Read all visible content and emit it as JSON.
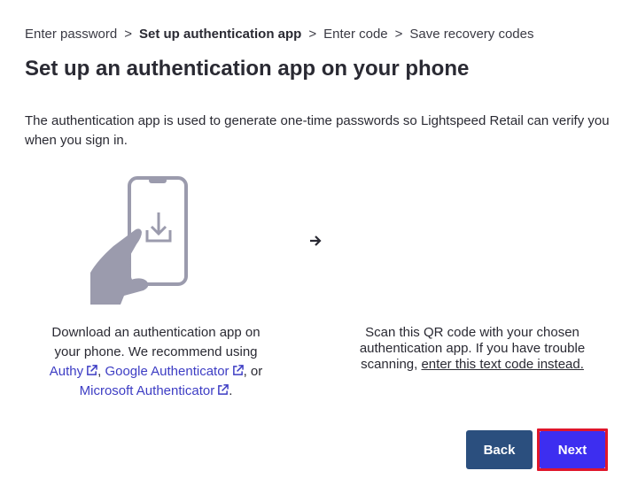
{
  "breadcrumb": {
    "steps": [
      "Enter password",
      "Set up authentication app",
      "Enter code",
      "Save recovery codes"
    ],
    "separator": ">"
  },
  "page": {
    "title": "Set up an authentication app on your phone",
    "intro": "The authentication app is used to generate one-time passwords so Lightspeed Retail can verify you when you sign in."
  },
  "download": {
    "text_before": "Download an authentication app on your phone. We recommend using ",
    "authy": "Authy",
    "google": "Google Authenticator",
    "comma_or": ", or",
    "microsoft": "Microsoft Authenticator",
    "period": "."
  },
  "scan": {
    "text": "Scan this QR code with your chosen authentication app. If you have trouble scanning, ",
    "link": "enter this text code instead."
  },
  "buttons": {
    "back": "Back",
    "next": "Next"
  },
  "colors": {
    "link": "#3d3dc4",
    "back_button": "#2b4f7e",
    "next_button": "#3d2ef0",
    "highlight_frame": "#e0162b",
    "illustration": "#9b9bad"
  },
  "icons": {
    "phone": "phone-download-icon",
    "arrow": "arrow-right-icon",
    "external": "external-link-icon"
  }
}
